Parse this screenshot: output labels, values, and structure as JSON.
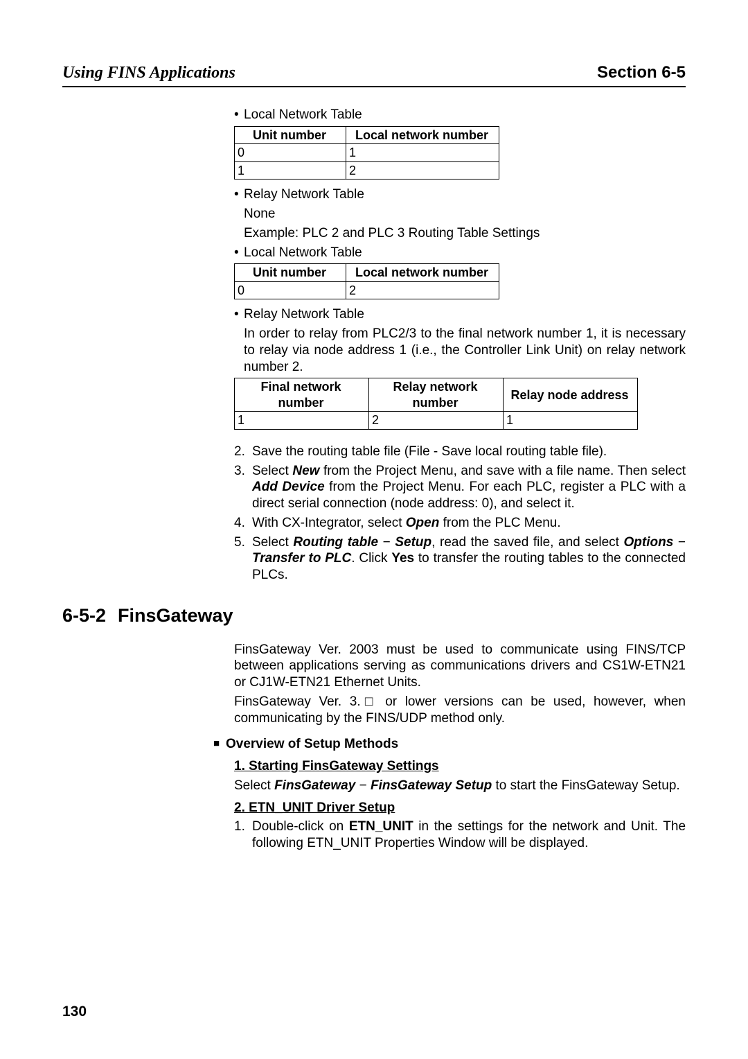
{
  "header": {
    "left": "Using FINS Applications",
    "right": "Section 6-5"
  },
  "bullets": {
    "local_net_table": "Local Network Table",
    "relay_net_table": "Relay Network Table",
    "none": "None",
    "example_caption": "Example: PLC 2 and PLC 3 Routing Table Settings",
    "relay_intro": "In order to relay from PLC2/3 to the final network number 1, it is necessary to relay via node address 1 (i.e., the Controller Link Unit) on relay network number 2."
  },
  "tables": {
    "local1": {
      "headers": [
        "Unit number",
        "Local network number"
      ],
      "rows": [
        [
          "0",
          "1"
        ],
        [
          "1",
          "2"
        ]
      ]
    },
    "local2": {
      "headers": [
        "Unit number",
        "Local network number"
      ],
      "rows": [
        [
          "0",
          "2"
        ]
      ]
    },
    "relay": {
      "headers": [
        "Final network number",
        "Relay network number",
        "Relay node address"
      ],
      "rows": [
        [
          "1",
          "2",
          "1"
        ]
      ]
    }
  },
  "steps": {
    "s2": "Save the routing table file (File - Save local routing table file).",
    "s3_a": "Select ",
    "s3_new": "New",
    "s3_b": " from the Project Menu, and save with a file name. Then select ",
    "s3_add": "Add Device",
    "s3_c": " from the Project Menu. For each PLC, register a PLC with a direct serial connection (node address: 0), and select it.",
    "s4_a": "With CX-Integrator, select ",
    "s4_open": "Open",
    "s4_b": " from the PLC Menu.",
    "s5_a": "Select ",
    "s5_rt": "Routing table",
    "s5_dash": " − ",
    "s5_setup": "Setup",
    "s5_b": ", read the saved file, and select ",
    "s5_opt": "Options",
    "s5_c": " − ",
    "s5_trans": "Transfer to PLC",
    "s5_d": ". Click ",
    "s5_yes": "Yes",
    "s5_e": " to transfer the routing tables to the connected PLCs."
  },
  "section": {
    "num": "6-5-2",
    "title": "FinsGateway",
    "p1": "FinsGateway Ver. 2003 must be used to communicate using FINS/TCP between applications serving as communications drivers and CS1W-ETN21 or CJ1W-ETN21 Ethernet Units.",
    "p2": "FinsGateway Ver. 3.□ or lower versions can be used, however, when communicating by the FINS/UDP method only.",
    "overview": "Overview of Setup Methods",
    "sub1": "1. Starting FinsGateway Settings",
    "sub1_a": "Select ",
    "sub1_fg": "FinsGateway",
    "sub1_dash": " − ",
    "sub1_fgs": "FinsGateway Setup",
    "sub1_b": " to start the FinsGateway Setup.",
    "sub2": "2. ETN_UNIT Driver Setup",
    "sub2_s1_a": "Double-click on ",
    "sub2_s1_etn": "ETN_UNIT",
    "sub2_s1_b": " in the settings for the network and Unit. The following ETN_UNIT Properties Window will be displayed."
  },
  "page": "130"
}
